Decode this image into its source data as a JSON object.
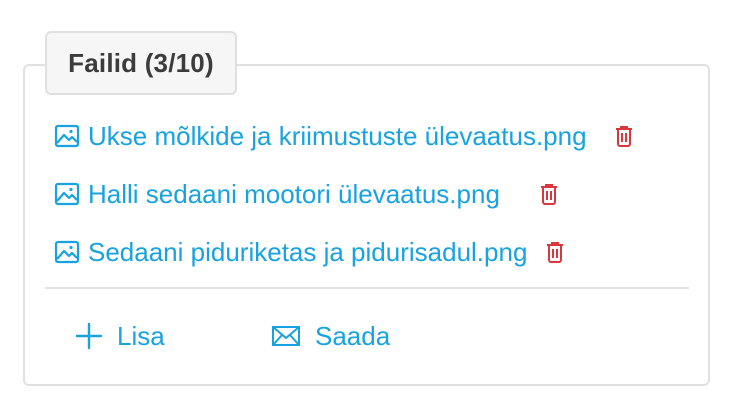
{
  "panel": {
    "title": "Failid (3/10)"
  },
  "files": [
    {
      "name": "Ukse mõlkide ja kriimustuste ülevaatus.png"
    },
    {
      "name": "Halli sedaani mootori ülevaatus.png"
    },
    {
      "name": "Sedaani piduriketas ja pidurisadul.png"
    }
  ],
  "actions": {
    "add_label": "Lisa",
    "send_label": "Saada"
  },
  "colors": {
    "accent": "#18a2e0",
    "danger": "#d9363e",
    "border": "#e0e0e0",
    "legend_bg": "#f6f6f6",
    "title_text": "#3c3c3c"
  },
  "icons": {
    "file": "image-icon",
    "delete": "trash-icon",
    "add": "plus-icon",
    "send": "envelope-icon"
  }
}
